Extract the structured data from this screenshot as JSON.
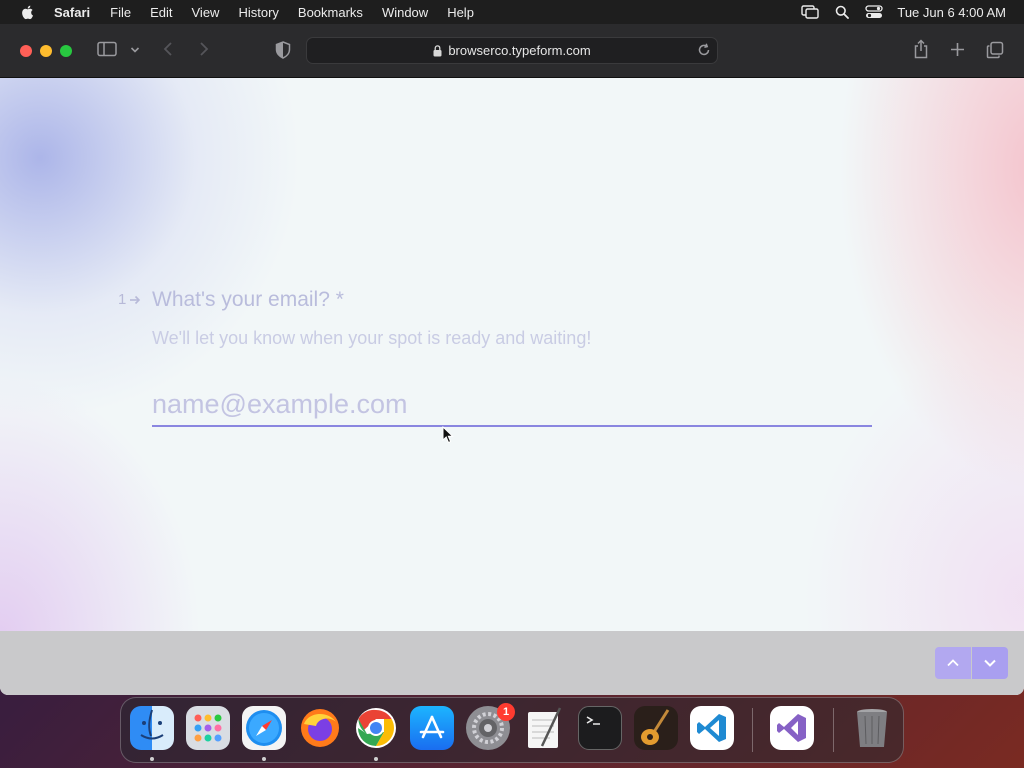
{
  "menubar": {
    "app_name": "Safari",
    "items": [
      "File",
      "Edit",
      "View",
      "History",
      "Bookmarks",
      "Window",
      "Help"
    ],
    "clock": "Tue Jun 6  4:00 AM"
  },
  "browser": {
    "url": "browserco.typeform.com"
  },
  "form": {
    "question_number": "1",
    "question_title": "What's your email? *",
    "question_subtitle": "We'll let you know when your spot is ready and waiting!",
    "email_placeholder": "name@example.com"
  },
  "dock": {
    "badge_count": "1",
    "apps": [
      "finder",
      "launchpad",
      "safari",
      "firefox",
      "chrome",
      "app-store",
      "system-preferences",
      "textedit",
      "terminal",
      "garageband",
      "vscode",
      "visual-studio",
      "trash"
    ]
  },
  "colors": {
    "accent": "#8a86e0",
    "nav_button": "#b2a8f0",
    "question_text": "#b9bcdc"
  }
}
